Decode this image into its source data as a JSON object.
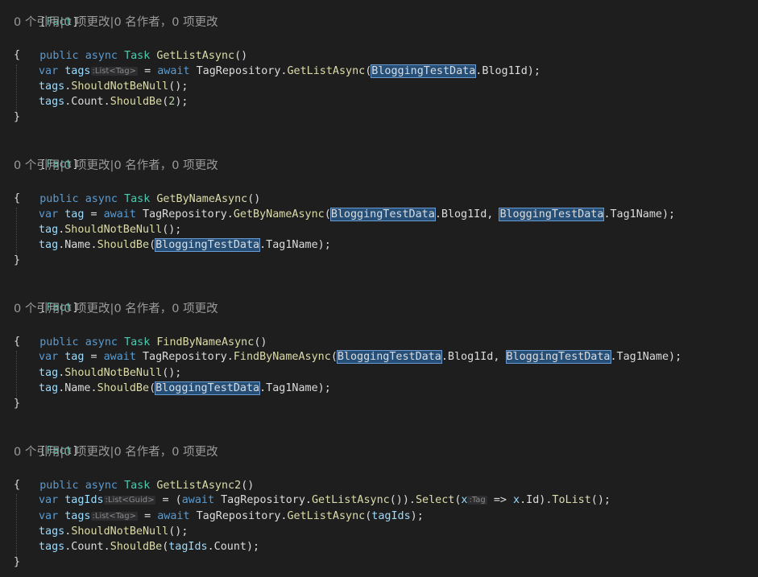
{
  "codelens": "0 个引用|0 项更改|0 名作者，0 项更改",
  "tokens": {
    "fact_open": "[",
    "fact": "Fact",
    "fact_close": "]",
    "public": "public",
    "async": "async",
    "task": "Task",
    "var": "var",
    "await": "await",
    "open_brace": "{",
    "close_brace": "}"
  },
  "blocks": [
    {
      "method": "GetListAsync",
      "params": "()",
      "lines": [
        {
          "id": "b1l1",
          "parts": [
            {
              "t": "kw",
              "v": "var"
            },
            {
              "t": "plain",
              "v": " "
            },
            {
              "t": "var",
              "v": "tags"
            },
            {
              "t": "hint",
              "v": ":List<Tag>"
            },
            {
              "t": "plain",
              "v": " = "
            },
            {
              "t": "kw",
              "v": "await"
            },
            {
              "t": "plain",
              "v": " TagRepository."
            },
            {
              "t": "method",
              "v": "GetListAsync"
            },
            {
              "t": "plain",
              "v": "("
            },
            {
              "t": "hl",
              "v": "BloggingTestData"
            },
            {
              "t": "plain",
              "v": ".Blog1Id);"
            }
          ]
        },
        {
          "id": "b1l2",
          "parts": [
            {
              "t": "var",
              "v": "tags"
            },
            {
              "t": "plain",
              "v": "."
            },
            {
              "t": "method",
              "v": "ShouldNotBeNull"
            },
            {
              "t": "plain",
              "v": "();"
            }
          ]
        },
        {
          "id": "b1l3",
          "parts": [
            {
              "t": "var",
              "v": "tags"
            },
            {
              "t": "plain",
              "v": ".Count."
            },
            {
              "t": "method",
              "v": "ShouldBe"
            },
            {
              "t": "plain",
              "v": "("
            },
            {
              "t": "num",
              "v": "2"
            },
            {
              "t": "plain",
              "v": ");"
            }
          ]
        }
      ]
    },
    {
      "method": "GetByNameAsync",
      "params": "()",
      "lines": [
        {
          "id": "b2l1",
          "parts": [
            {
              "t": "kw",
              "v": "var"
            },
            {
              "t": "plain",
              "v": " "
            },
            {
              "t": "var",
              "v": "tag"
            },
            {
              "t": "plain",
              "v": " = "
            },
            {
              "t": "kw",
              "v": "await"
            },
            {
              "t": "plain",
              "v": " TagRepository."
            },
            {
              "t": "method",
              "v": "GetByNameAsync"
            },
            {
              "t": "plain",
              "v": "("
            },
            {
              "t": "hl",
              "v": "BloggingTestData"
            },
            {
              "t": "plain",
              "v": ".Blog1Id, "
            },
            {
              "t": "hl",
              "v": "BloggingTestData"
            },
            {
              "t": "plain",
              "v": ".Tag1Name);"
            }
          ]
        },
        {
          "id": "b2l2",
          "parts": [
            {
              "t": "var",
              "v": "tag"
            },
            {
              "t": "plain",
              "v": "."
            },
            {
              "t": "method",
              "v": "ShouldNotBeNull"
            },
            {
              "t": "plain",
              "v": "();"
            }
          ]
        },
        {
          "id": "b2l3",
          "parts": [
            {
              "t": "var",
              "v": "tag"
            },
            {
              "t": "plain",
              "v": ".Name."
            },
            {
              "t": "method",
              "v": "ShouldBe"
            },
            {
              "t": "plain",
              "v": "("
            },
            {
              "t": "hl",
              "v": "BloggingTestData"
            },
            {
              "t": "plain",
              "v": ".Tag1Name);"
            }
          ]
        }
      ]
    },
    {
      "method": "FindByNameAsync",
      "params": "()",
      "lines": [
        {
          "id": "b3l1",
          "parts": [
            {
              "t": "kw",
              "v": "var"
            },
            {
              "t": "plain",
              "v": " "
            },
            {
              "t": "var",
              "v": "tag"
            },
            {
              "t": "plain",
              "v": " = "
            },
            {
              "t": "kw",
              "v": "await"
            },
            {
              "t": "plain",
              "v": " TagRepository."
            },
            {
              "t": "method",
              "v": "FindByNameAsync"
            },
            {
              "t": "plain",
              "v": "("
            },
            {
              "t": "hl",
              "v": "BloggingTestData"
            },
            {
              "t": "plain",
              "v": ".Blog1Id, "
            },
            {
              "t": "hl",
              "v": "BloggingTestData"
            },
            {
              "t": "plain",
              "v": ".Tag1Name);"
            }
          ]
        },
        {
          "id": "b3l2",
          "parts": [
            {
              "t": "var",
              "v": "tag"
            },
            {
              "t": "plain",
              "v": "."
            },
            {
              "t": "method",
              "v": "ShouldNotBeNull"
            },
            {
              "t": "plain",
              "v": "();"
            }
          ]
        },
        {
          "id": "b3l3",
          "parts": [
            {
              "t": "var",
              "v": "tag"
            },
            {
              "t": "plain",
              "v": ".Name."
            },
            {
              "t": "method",
              "v": "ShouldBe"
            },
            {
              "t": "plain",
              "v": "("
            },
            {
              "t": "hl",
              "v": "BloggingTestData"
            },
            {
              "t": "plain",
              "v": ".Tag1Name);"
            }
          ]
        }
      ]
    },
    {
      "method": "GetListAsync2",
      "params": "()",
      "lines": [
        {
          "id": "b4l1",
          "parts": [
            {
              "t": "kw",
              "v": "var"
            },
            {
              "t": "plain",
              "v": " "
            },
            {
              "t": "var",
              "v": "tagIds"
            },
            {
              "t": "hint",
              "v": ":List<Guid>"
            },
            {
              "t": "plain",
              "v": " = ("
            },
            {
              "t": "kw",
              "v": "await"
            },
            {
              "t": "plain",
              "v": " TagRepository."
            },
            {
              "t": "method",
              "v": "GetListAsync"
            },
            {
              "t": "plain",
              "v": "())."
            },
            {
              "t": "method",
              "v": "Select"
            },
            {
              "t": "plain",
              "v": "("
            },
            {
              "t": "var",
              "v": "x"
            },
            {
              "t": "hint",
              "v": ":Tag"
            },
            {
              "t": "plain",
              "v": " => "
            },
            {
              "t": "var",
              "v": "x"
            },
            {
              "t": "plain",
              "v": ".Id)."
            },
            {
              "t": "method",
              "v": "ToList"
            },
            {
              "t": "plain",
              "v": "();"
            }
          ]
        },
        {
          "id": "b4l2",
          "parts": [
            {
              "t": "kw",
              "v": "var"
            },
            {
              "t": "plain",
              "v": " "
            },
            {
              "t": "var",
              "v": "tags"
            },
            {
              "t": "hint",
              "v": ":List<Tag>"
            },
            {
              "t": "plain",
              "v": " = "
            },
            {
              "t": "kw",
              "v": "await"
            },
            {
              "t": "plain",
              "v": " TagRepository."
            },
            {
              "t": "method",
              "v": "GetListAsync"
            },
            {
              "t": "plain",
              "v": "("
            },
            {
              "t": "var",
              "v": "tagIds"
            },
            {
              "t": "plain",
              "v": ");"
            }
          ]
        },
        {
          "id": "b4l3",
          "parts": [
            {
              "t": "var",
              "v": "tags"
            },
            {
              "t": "plain",
              "v": "."
            },
            {
              "t": "method",
              "v": "ShouldNotBeNull"
            },
            {
              "t": "plain",
              "v": "();"
            }
          ]
        },
        {
          "id": "b4l4",
          "parts": [
            {
              "t": "var",
              "v": "tags"
            },
            {
              "t": "plain",
              "v": ".Count."
            },
            {
              "t": "method",
              "v": "ShouldBe"
            },
            {
              "t": "plain",
              "v": "("
            },
            {
              "t": "var",
              "v": "tagIds"
            },
            {
              "t": "plain",
              "v": ".Count);"
            }
          ]
        }
      ]
    }
  ]
}
